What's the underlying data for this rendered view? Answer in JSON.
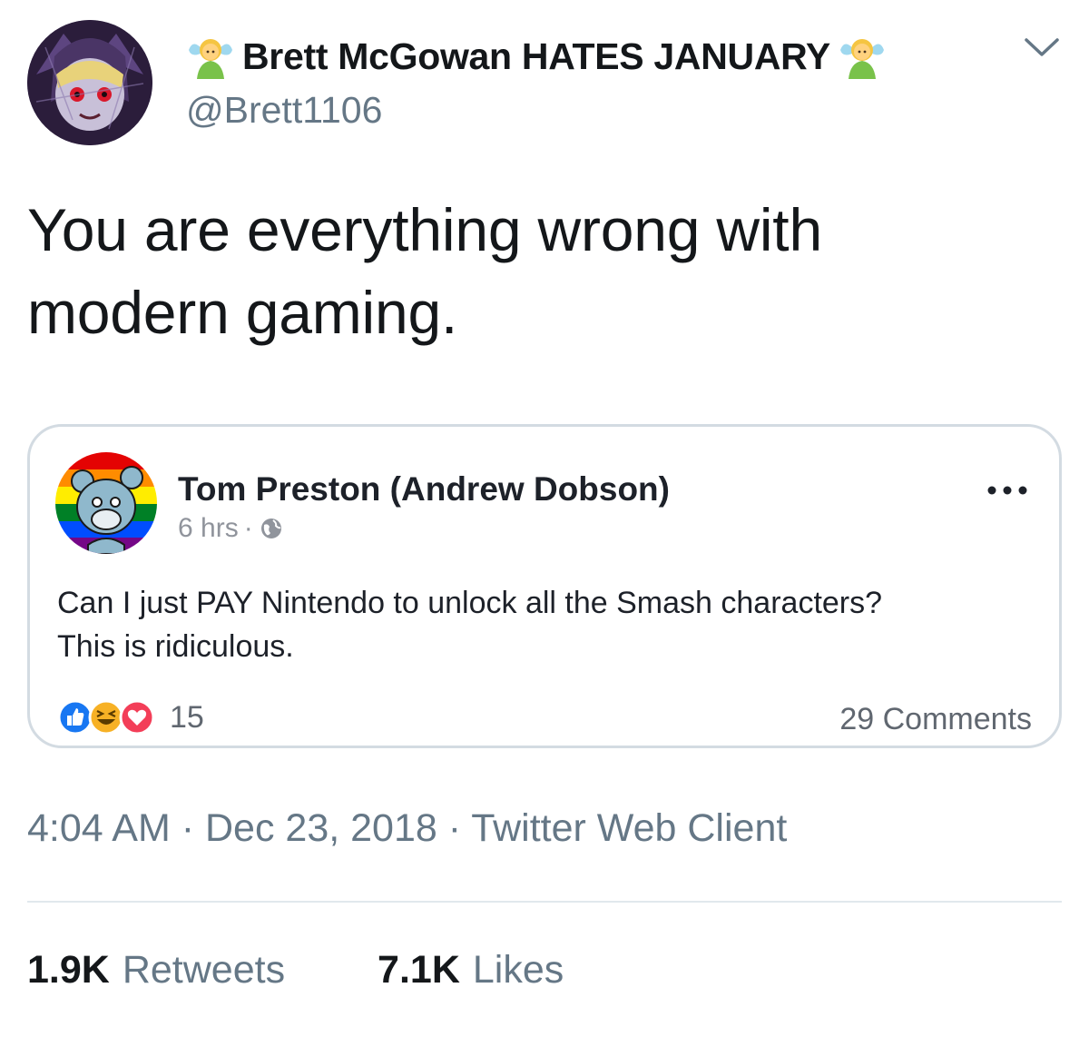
{
  "author": {
    "display_name": "Brett McGowan HATES JANUARY",
    "handle": "@Brett1106",
    "emoji_icon": "fairy-emoji"
  },
  "tweet": {
    "text": "You are everything wrong with modern gaming."
  },
  "quoted_post": {
    "name": "Tom Preston (Andrew Dobson)",
    "time": "6 hrs",
    "separator": "·",
    "privacy_icon": "globe-icon",
    "body_line1": "Can I just PAY Nintendo to unlock all the Smash characters?",
    "body_line2": "This is ridiculous.",
    "reaction_icons": [
      "like-icon",
      "haha-icon",
      "love-icon"
    ],
    "reaction_count": "15",
    "comments": "29 Comments"
  },
  "meta": {
    "time": "4:04 AM",
    "date": "Dec 23, 2018",
    "client": "Twitter Web Client",
    "separator": " · "
  },
  "stats": {
    "retweets_count": "1.9K",
    "retweets_label": "Retweets",
    "likes_count": "7.1K",
    "likes_label": "Likes"
  },
  "colors": {
    "text": "#14171a",
    "secondary": "#657786",
    "card_border": "#d3dbe2",
    "like_blue": "#1877f2",
    "love_red": "#f33e58",
    "haha_yellow": "#f7b125"
  }
}
